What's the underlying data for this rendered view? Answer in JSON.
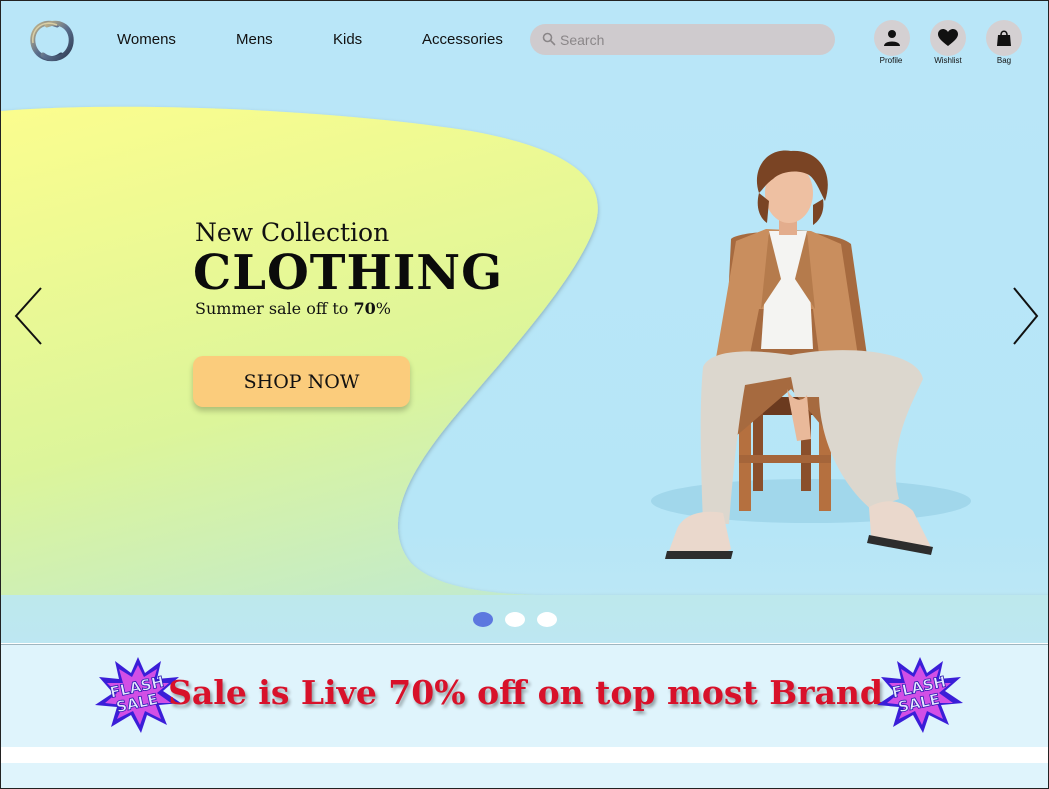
{
  "header": {
    "nav": [
      "Womens",
      "Mens",
      "Kids",
      "Accessories"
    ],
    "search": {
      "placeholder": "Search",
      "value": ""
    },
    "actions": [
      {
        "label": "Profile",
        "icon": "user-icon"
      },
      {
        "label": "Wishlist",
        "icon": "heart-icon"
      },
      {
        "label": "Bag",
        "icon": "bag-icon"
      }
    ]
  },
  "hero": {
    "eyebrow": "New Collection",
    "title": "CLOTHING",
    "subtitle_prefix": "Summer sale off to ",
    "subtitle_value": "70",
    "subtitle_suffix": "%",
    "cta": "SHOP NOW",
    "slides_total": 3,
    "slide_active": 1,
    "accent_colors": {
      "blob": "#f7f58f",
      "cta": "#fbcc7c",
      "dot_active": "#5d78df"
    }
  },
  "promo": {
    "text": "Sale is Live 70% off on top most Brand",
    "badge_text_line1": "FLASH",
    "badge_text_line2": "SALE",
    "text_color": "#d8112a"
  }
}
